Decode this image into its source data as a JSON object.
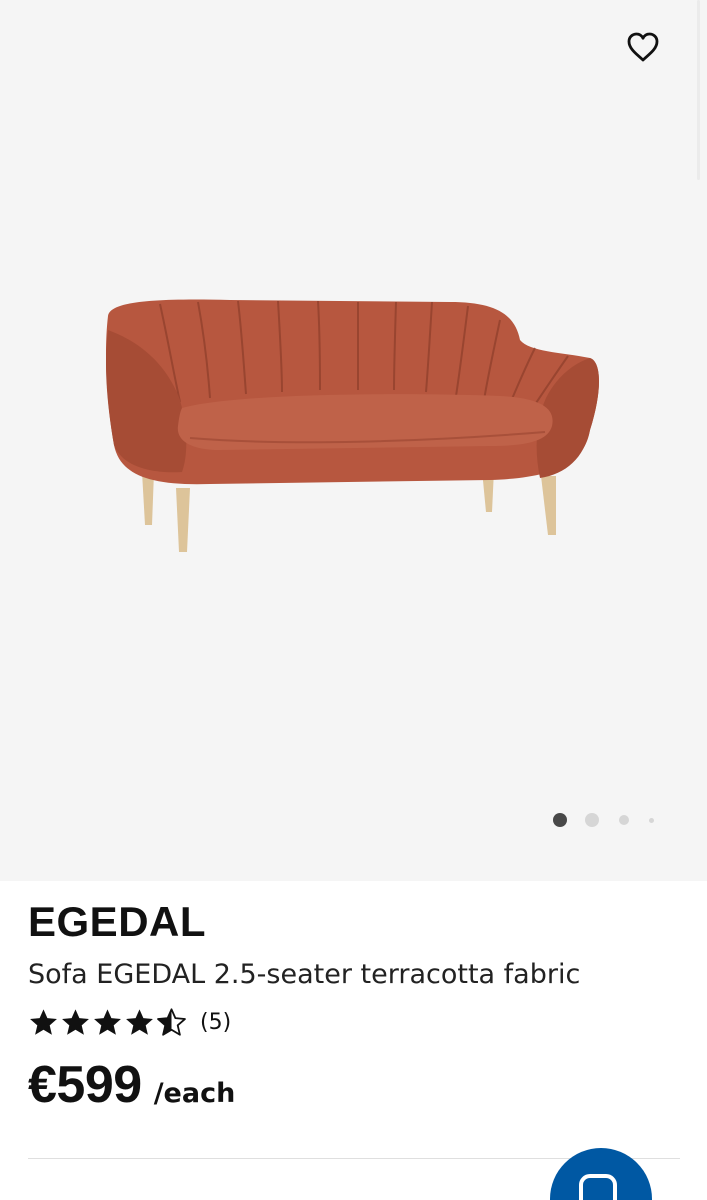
{
  "gallery": {
    "favorite_icon": "heart-outline-icon",
    "image_subject": "terracotta fabric sofa",
    "dots_count": 4,
    "active_index": 0
  },
  "product": {
    "name": "EGEDAL",
    "description": "Sofa EGEDAL 2.5-seater terracotta fabric",
    "rating": {
      "stars": 4.5,
      "max_stars": 5,
      "count_label": "(5)"
    },
    "price": {
      "amount": "€599",
      "unit": "/each"
    }
  },
  "fab": {
    "icon": "chat-icon",
    "color": "#0058a3"
  },
  "colors": {
    "hero_background": "#f5f5f5",
    "sofa": "#b7573f",
    "legs": "#ddc49a"
  }
}
